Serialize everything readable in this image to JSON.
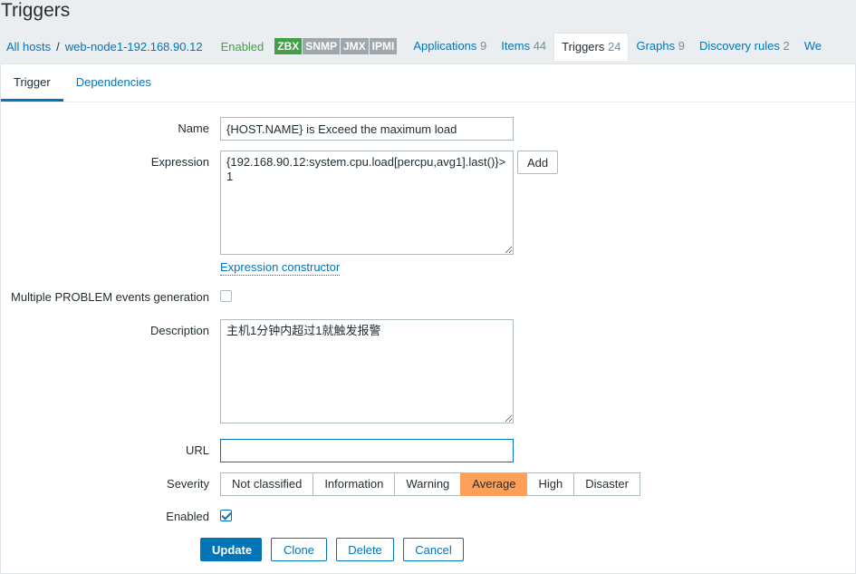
{
  "page": {
    "title": "Triggers"
  },
  "host_nav": {
    "all_hosts": "All hosts",
    "separator": "/",
    "host": "web-node1-192.168.90.12",
    "status": "Enabled",
    "availability": [
      "ZBX",
      "SNMP",
      "JMX",
      "IPMI"
    ],
    "tabs": [
      {
        "label": "Applications",
        "count": "9"
      },
      {
        "label": "Items",
        "count": "44"
      },
      {
        "label": "Triggers",
        "count": "24"
      },
      {
        "label": "Graphs",
        "count": "9"
      },
      {
        "label": "Discovery rules",
        "count": "2"
      },
      {
        "label": "We",
        "count": ""
      }
    ]
  },
  "form_tabs": [
    "Trigger",
    "Dependencies"
  ],
  "form": {
    "name_label": "Name",
    "name_value": "{HOST.NAME} is Exceed the maximum load",
    "expression_label": "Expression",
    "expression_value": "{192.168.90.12:system.cpu.load[percpu,avg1].last()}>1",
    "add_button": "Add",
    "expression_constructor": "Expression constructor",
    "multiple_problem_label": "Multiple PROBLEM events generation",
    "multiple_problem_checked": false,
    "description_label": "Description",
    "description_value": "主机1分钟内超过1就触发报警",
    "url_label": "URL",
    "url_value": "",
    "severity_label": "Severity",
    "severity_options": [
      "Not classified",
      "Information",
      "Warning",
      "Average",
      "High",
      "Disaster"
    ],
    "severity_selected": "Average",
    "enabled_label": "Enabled",
    "enabled_checked": true
  },
  "actions": {
    "update": "Update",
    "clone": "Clone",
    "delete": "Delete",
    "cancel": "Cancel"
  },
  "colors": {
    "accent": "#0275b8",
    "enabled_green": "#429e47",
    "severity_average": "#ffa059",
    "availability_off": "#9ea7ad"
  }
}
